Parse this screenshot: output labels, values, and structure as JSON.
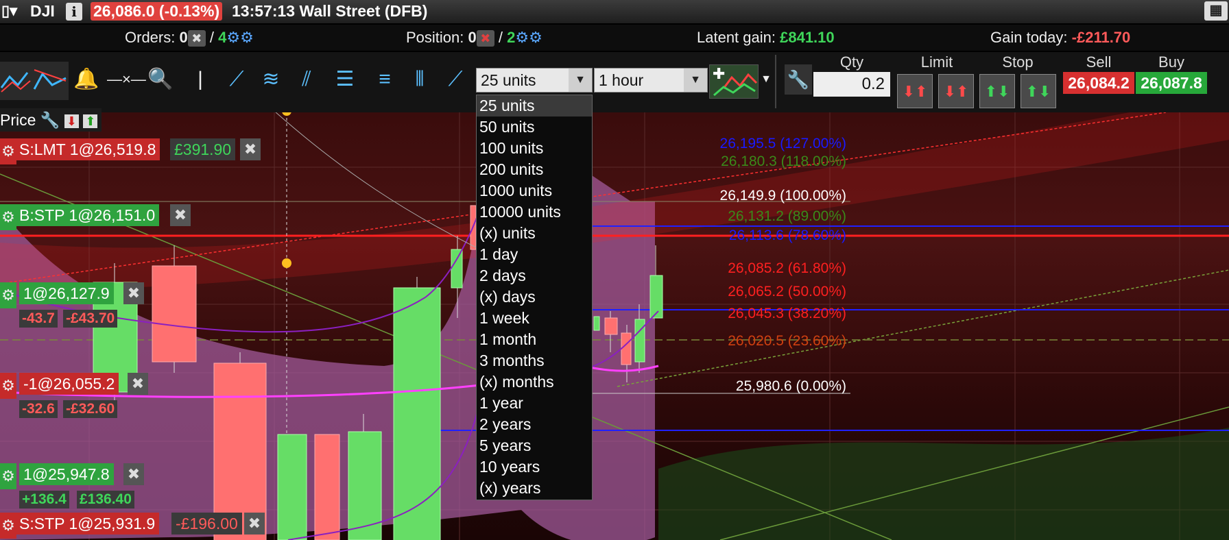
{
  "titlebar": {
    "symbol": "DJI",
    "info_icon_glyph": "i",
    "price_change": "26,086.0 (-0.13%)",
    "time_market": "13:57:13 Wall Street (DFB)"
  },
  "infobar": {
    "orders_label": "Orders:",
    "orders_count": "0",
    "orders_sep": "/",
    "orders_pending": "4",
    "position_label": "Position:",
    "position_count": "0",
    "position_sep": "/",
    "position_pending": "2",
    "latent_label": "Latent gain:",
    "latent_value": "£841.10",
    "today_label": "Gain today:",
    "today_value": "-£211.70"
  },
  "toolbar": {
    "units_select": "25 units",
    "interval_select": "1 hour"
  },
  "trade": {
    "qty_label": "Qty",
    "qty_value": "0.2",
    "limit_label": "Limit",
    "stop_label": "Stop",
    "sell_label": "Sell",
    "buy_label": "Buy",
    "sell_price": "26,084.2",
    "buy_price": "26,087.8"
  },
  "dropdown": {
    "options": [
      "25 units",
      "50 units",
      "100 units",
      "200 units",
      "1000 units",
      "10000 units",
      "(x) units",
      "1 day",
      "2 days",
      "(x) days",
      "1 week",
      "1 month",
      "3 months",
      "(x) months",
      "1 year",
      "2 years",
      "5 years",
      "10 years",
      "(x) years"
    ],
    "selected": "25 units"
  },
  "chart": {
    "price_label": "Price",
    "fib_levels": [
      {
        "text": "26,195.5 (127.00%)",
        "color": "#1a1aff"
      },
      {
        "text": "26,180.3 (118.00%)",
        "color": "#3a8a1a"
      },
      {
        "text": "26,149.9 (100.00%)",
        "color": "#ffffff"
      },
      {
        "text": "26,131.2 (89.00%)",
        "color": "#3a8a1a"
      },
      {
        "text": "26,113.6 (78.60%)",
        "color": "#1a1aff"
      },
      {
        "text": "26,085.2 (61.80%)",
        "color": "#ff2020"
      },
      {
        "text": "26,065.2 (50.00%)",
        "color": "#ff2020"
      },
      {
        "text": "26,045.3 (38.20%)",
        "color": "#ff2020"
      },
      {
        "text": "26,020.5 (23.60%)",
        "color": "#d04010"
      },
      {
        "text": "25,980.6 (0.00%)",
        "color": "#ffffff"
      }
    ],
    "orders": {
      "s_lmt": "S:LMT 1@26,519.8",
      "s_lmt_pl": "£391.90",
      "b_stp": "B:STP 1@26,151.0",
      "pos1": "1@26,127.9",
      "pos1_pts": "-43.7",
      "pos1_pl": "-£43.70",
      "pos2": "-1@26,055.2",
      "pos2_pts": "-32.6",
      "pos2_pl": "-£32.60",
      "pos3": "1@25,947.8",
      "pos3_pts": "+136.4",
      "pos3_pl": "£136.40",
      "s_stp": "S:STP 1@25,931.9",
      "s_stp_pl": "-£196.00"
    }
  }
}
